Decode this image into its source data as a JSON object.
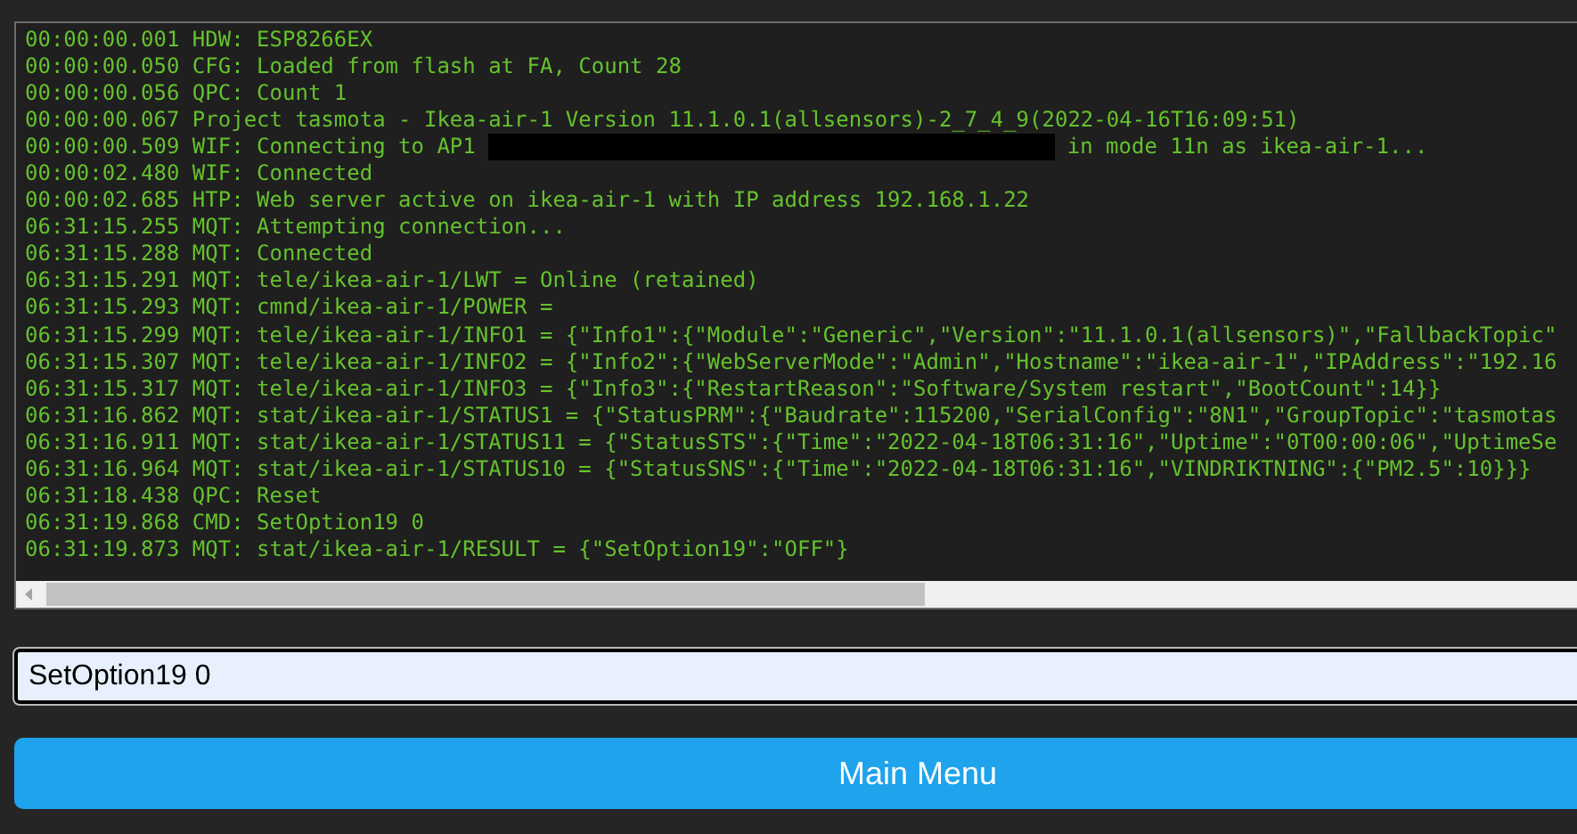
{
  "console_log": {
    "lines": [
      {
        "text": "00:00:00.001 HDW: ESP8266EX"
      },
      {
        "text": "00:00:00.050 CFG: Loaded from flash at FA, Count 28"
      },
      {
        "text": "00:00:00.056 QPC: Count 1"
      },
      {
        "text": "00:00:00.067 Project tasmota - Ikea-air-1 Version 11.1.0.1(allsensors)-2_7_4_9(2022-04-16T16:09:51)"
      },
      {
        "text": "00:00:00.509 WIF: Connecting to AP1",
        "redacted": true,
        "tail": "in mode 11n as ikea-air-1..."
      },
      {
        "text": "00:00:02.480 WIF: Connected"
      },
      {
        "text": "00:00:02.685 HTP: Web server active on ikea-air-1 with IP address 192.168.1.22"
      },
      {
        "text": "06:31:15.255 MQT: Attempting connection..."
      },
      {
        "text": "06:31:15.288 MQT: Connected"
      },
      {
        "text": "06:31:15.291 MQT: tele/ikea-air-1/LWT = Online (retained)"
      },
      {
        "text": "06:31:15.293 MQT: cmnd/ikea-air-1/POWER ="
      },
      {
        "text": "06:31:15.299 MQT: tele/ikea-air-1/INFO1 = {\"Info1\":{\"Module\":\"Generic\",\"Version\":\"11.1.0.1(allsensors)\",\"FallbackTopic\""
      },
      {
        "text": "06:31:15.307 MQT: tele/ikea-air-1/INFO2 = {\"Info2\":{\"WebServerMode\":\"Admin\",\"Hostname\":\"ikea-air-1\",\"IPAddress\":\"192.16"
      },
      {
        "text": "06:31:15.317 MQT: tele/ikea-air-1/INFO3 = {\"Info3\":{\"RestartReason\":\"Software/System restart\",\"BootCount\":14}}"
      },
      {
        "text": "06:31:16.862 MQT: stat/ikea-air-1/STATUS1 = {\"StatusPRM\":{\"Baudrate\":115200,\"SerialConfig\":\"8N1\",\"GroupTopic\":\"tasmotas"
      },
      {
        "text": "06:31:16.911 MQT: stat/ikea-air-1/STATUS11 = {\"StatusSTS\":{\"Time\":\"2022-04-18T06:31:16\",\"Uptime\":\"0T00:00:06\",\"UptimeSe"
      },
      {
        "text": "06:31:16.964 MQT: stat/ikea-air-1/STATUS10 = {\"StatusSNS\":{\"Time\":\"2022-04-18T06:31:16\",\"VINDRIKTNING\":{\"PM2.5\":10}}}"
      },
      {
        "text": "06:31:18.438 QPC: Reset"
      },
      {
        "text": "06:31:19.868 CMD: SetOption19 0"
      },
      {
        "text": "06:31:19.873 MQT: stat/ikea-air-1/RESULT = {\"SetOption19\":\"OFF\"}"
      }
    ]
  },
  "command_input": {
    "value": "SetOption19 0"
  },
  "main_menu_button": {
    "label": "Main Menu"
  }
}
